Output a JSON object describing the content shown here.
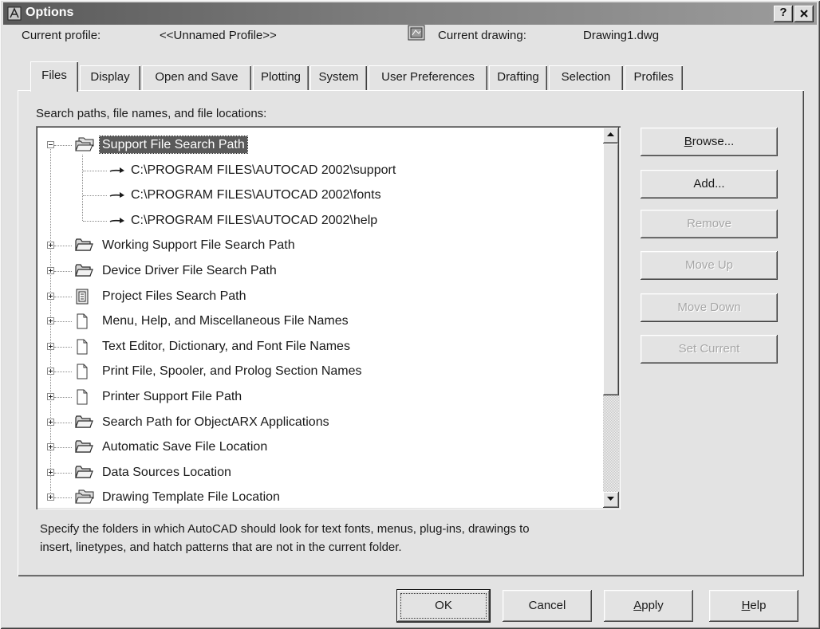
{
  "window": {
    "title": "Options",
    "help_label": "?"
  },
  "header": {
    "current_profile_label": "Current profile:",
    "current_profile_value": "<<Unnamed Profile>>",
    "current_drawing_label": "Current drawing:",
    "current_drawing_value": "Drawing1.dwg"
  },
  "tabs": [
    {
      "label": "Files",
      "selected": true
    },
    {
      "label": "Display",
      "selected": false
    },
    {
      "label": "Open and Save",
      "selected": false
    },
    {
      "label": "Plotting",
      "selected": false
    },
    {
      "label": "System",
      "selected": false
    },
    {
      "label": "User Preferences",
      "selected": false
    },
    {
      "label": "Drafting",
      "selected": false
    },
    {
      "label": "Selection",
      "selected": false
    },
    {
      "label": "Profiles",
      "selected": false
    }
  ],
  "files": {
    "section_label": "Search paths, file names, and file locations:",
    "tree": [
      {
        "label": "Support File Search Path",
        "icon": "folders-icon",
        "expanded": true,
        "selected": true,
        "children": [
          {
            "label": "C:\\PROGRAM FILES\\AUTOCAD 2002\\support",
            "icon": "path-arrow-icon"
          },
          {
            "label": "C:\\PROGRAM FILES\\AUTOCAD 2002\\fonts",
            "icon": "path-arrow-icon"
          },
          {
            "label": "C:\\PROGRAM FILES\\AUTOCAD 2002\\help",
            "icon": "path-arrow-icon"
          }
        ]
      },
      {
        "label": "Working Support File Search Path",
        "icon": "folder-icon",
        "expanded": false
      },
      {
        "label": "Device Driver File Search Path",
        "icon": "folder-icon",
        "expanded": false
      },
      {
        "label": "Project Files Search Path",
        "icon": "project-icon",
        "expanded": false
      },
      {
        "label": "Menu, Help, and Miscellaneous File Names",
        "icon": "file-icon",
        "expanded": false
      },
      {
        "label": "Text Editor, Dictionary, and Font File Names",
        "icon": "file-icon",
        "expanded": false
      },
      {
        "label": "Print File, Spooler, and Prolog Section Names",
        "icon": "file-icon",
        "expanded": false
      },
      {
        "label": "Printer Support File Path",
        "icon": "file-icon",
        "expanded": false
      },
      {
        "label": "Search Path for ObjectARX Applications",
        "icon": "folder-icon",
        "expanded": false
      },
      {
        "label": "Automatic Save File Location",
        "icon": "folder-icon",
        "expanded": false
      },
      {
        "label": "Data Sources Location",
        "icon": "folder-icon",
        "expanded": false
      },
      {
        "label": "Drawing Template File Location",
        "icon": "folders-icon",
        "expanded": false
      }
    ],
    "description": [
      "Specify the folders in which AutoCAD should look for text fonts, menus, plug-ins, drawings to",
      "insert, linetypes, and hatch patterns that are not in the current folder."
    ]
  },
  "side_buttons": [
    {
      "label": "Browse...",
      "enabled": true
    },
    {
      "label": "Add...",
      "enabled": true
    },
    {
      "label": "Remove",
      "enabled": false
    },
    {
      "label": "Move Up",
      "enabled": false
    },
    {
      "label": "Move Down",
      "enabled": false
    },
    {
      "label": "Set Current",
      "enabled": false
    }
  ],
  "footer_buttons": [
    {
      "label": "OK",
      "default": true
    },
    {
      "label": "Cancel"
    },
    {
      "label": "Apply"
    },
    {
      "label": "Help"
    }
  ],
  "colors": {
    "dialog_background": "#e3e3e3",
    "title_bar": "#6a6a6a",
    "selection_highlight": "#5a5a5a",
    "list_background": "#ffffff",
    "disabled_text": "#a6a6a6"
  }
}
